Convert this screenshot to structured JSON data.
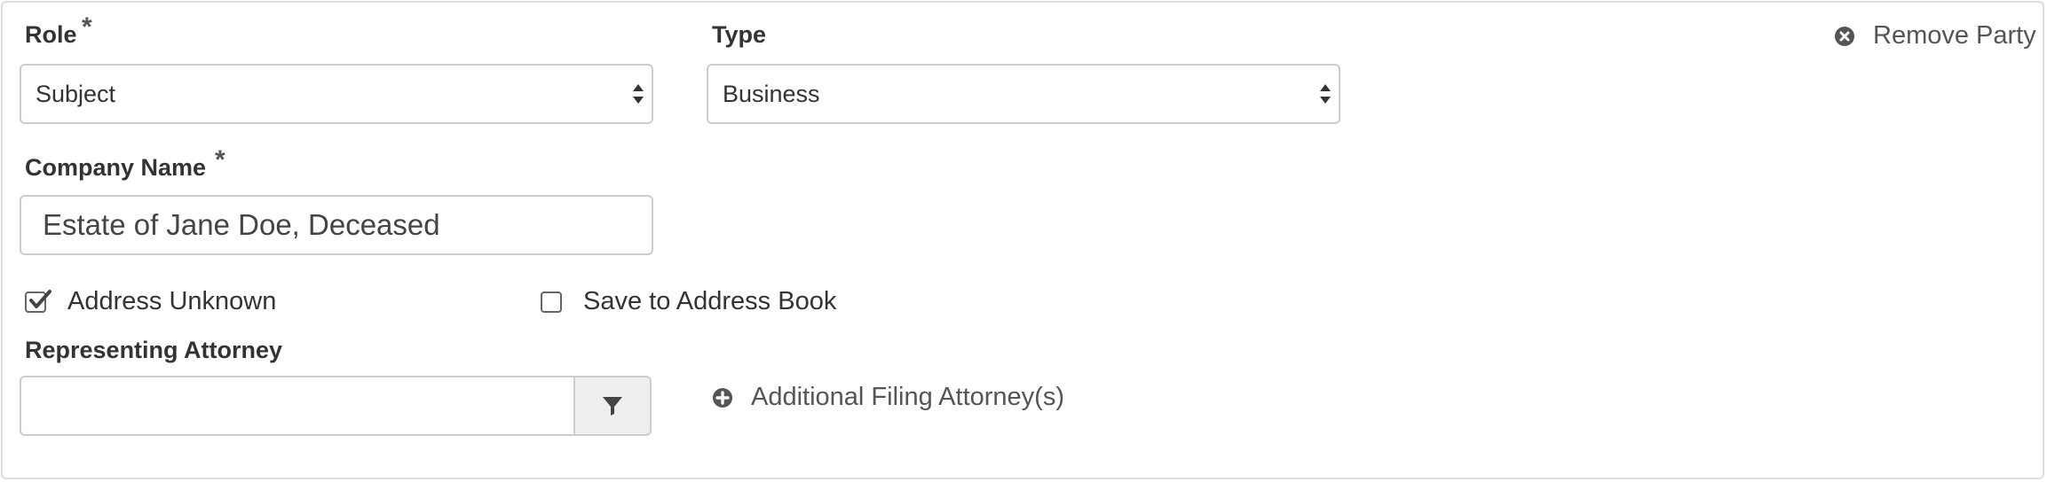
{
  "role": {
    "label": "Role",
    "required_mark": "*",
    "selected": "Subject"
  },
  "type": {
    "label": "Type",
    "selected": "Business"
  },
  "remove_party": {
    "label": "Remove Party",
    "icon": "times-circle-icon"
  },
  "company_name": {
    "label": "Company Name",
    "required_mark": "*",
    "value": "Estate of Jane Doe, Deceased"
  },
  "address_unknown": {
    "label": "Address Unknown",
    "checked": true
  },
  "save_address_book": {
    "label": "Save to Address Book",
    "checked": false
  },
  "representing_attorney": {
    "label": "Representing Attorney",
    "value": "",
    "filter_icon": "filter-icon"
  },
  "additional_attorney": {
    "label": "Additional Filing Attorney(s)",
    "icon": "plus-circle-icon"
  },
  "colors": {
    "border": "#cccccc",
    "panel_border": "#dddddd",
    "icon": "#555555",
    "button_bg": "#eeeeee"
  }
}
